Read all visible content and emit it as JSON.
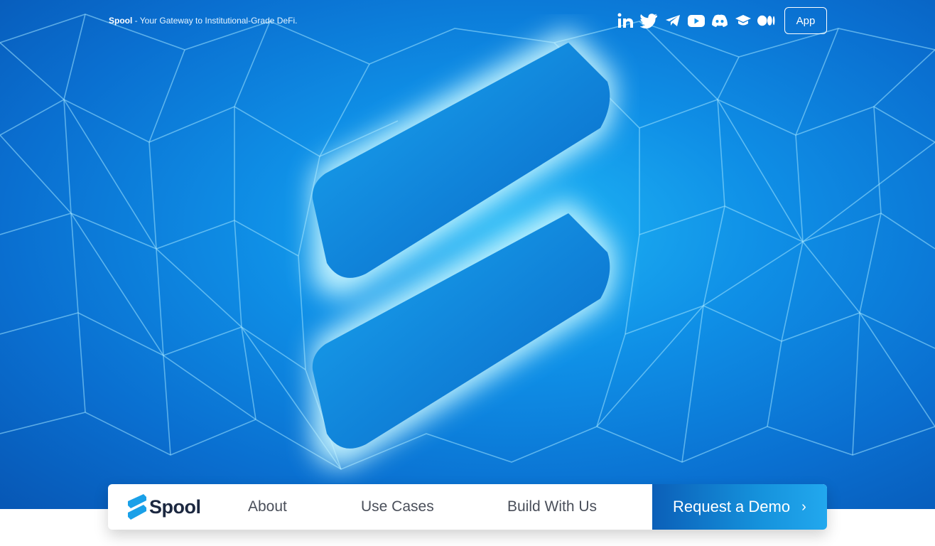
{
  "header": {
    "brand": "Spool",
    "tagline": " - Your Gateway to Institutional-Grade DeFi.",
    "app_button": "App"
  },
  "socials": [
    {
      "icon": "linkedin-icon"
    },
    {
      "icon": "twitter-icon"
    },
    {
      "icon": "telegram-icon"
    },
    {
      "icon": "youtube-icon"
    },
    {
      "icon": "discord-icon"
    },
    {
      "icon": "academy-icon"
    },
    {
      "icon": "medium-icon"
    }
  ],
  "nav": {
    "logo_text": "Spool",
    "links": [
      "About",
      "Use Cases",
      "Build With Us"
    ],
    "cta": "Request a Demo",
    "cta_chevron": "›"
  },
  "colors": {
    "hero_blue": "#0f8fe6",
    "glow": "#aef0ff",
    "logo_dark": "#1c2840",
    "cta_start": "#0b5fb8",
    "cta_end": "#22a8ee"
  }
}
